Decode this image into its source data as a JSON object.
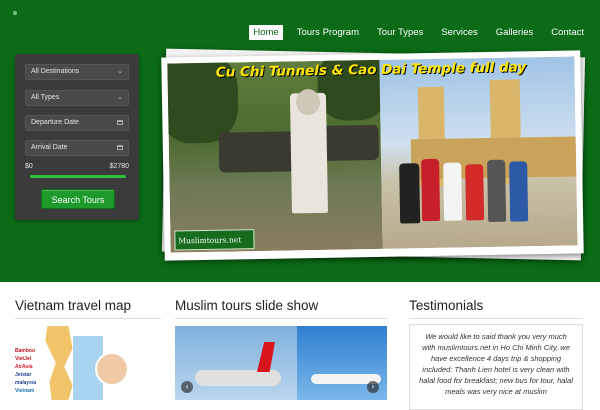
{
  "nav": {
    "items": [
      {
        "label": "Home",
        "active": true
      },
      {
        "label": "Tours Program",
        "active": false
      },
      {
        "label": "Tour Types",
        "active": false
      },
      {
        "label": "Services",
        "active": false
      },
      {
        "label": "Galleries",
        "active": false
      },
      {
        "label": "Contact",
        "active": false
      }
    ]
  },
  "search": {
    "destination": "All Destinations",
    "type": "All Types",
    "departure_placeholder": "Departure Date",
    "arrival_placeholder": "Arrival Date",
    "price_min": "$0",
    "price_max": "$2780",
    "price_range_fill": 1.0,
    "button_label": "Search Tours"
  },
  "featured": {
    "caption": "Cu Chi Tunnels & Cao Dai Temple full day",
    "watermark": "Muslimtours.net"
  },
  "map_section": {
    "title": "Vietnam travel map",
    "legend": [
      "Bamboo",
      "VietJet",
      "AirAsia",
      "Jetstar",
      "malaysia",
      "Vietnam"
    ]
  },
  "slideshow_section": {
    "title": "Muslim tours slide show",
    "prev_icon": "chevron-left-icon",
    "next_icon": "chevron-right-icon"
  },
  "testimonials": {
    "title": "Testimonials",
    "text": "We would like to said thank you very much with muslimtours.net in Ho Chi Minh City, we have excellence 4 days trip & shopping included: Thanh Lien hotel is very clean with halal food for breakfast; new bus for tour, halal meals was very nice at muslim"
  },
  "colors": {
    "brand_green": "#0b6b16",
    "button_green": "#1e9a2c",
    "panel_grey": "#3b3b3b",
    "caption_yellow": "#ffe600"
  }
}
